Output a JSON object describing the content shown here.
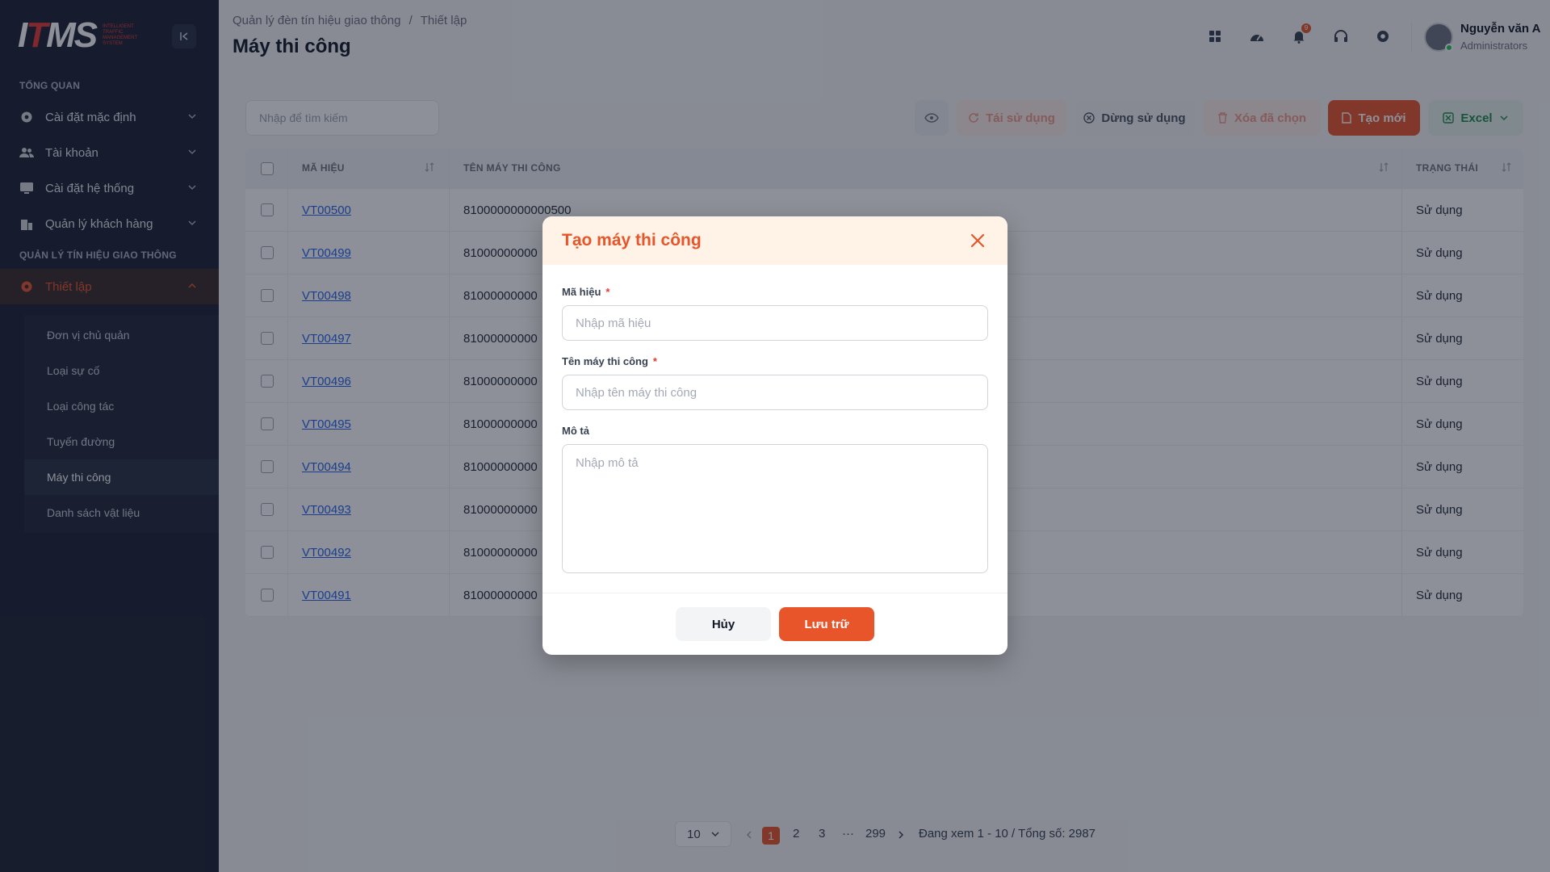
{
  "app": {
    "logo_text": "ITMS",
    "logo_subtitle": "INTELLIGENT TRAFFIC MANAGEMENT SYSTEM"
  },
  "sidebar": {
    "section_overview": "TỔNG QUAN",
    "items": [
      {
        "label": "Cài đặt mặc định",
        "icon": "gear-icon"
      },
      {
        "label": "Tài khoản",
        "icon": "users-icon"
      },
      {
        "label": "Cài đặt hệ thống",
        "icon": "monitor-icon"
      },
      {
        "label": "Quản lý khách hàng",
        "icon": "building-icon"
      }
    ],
    "section_traffic": "QUẢN LÝ TÍN HIỆU GIAO THÔNG",
    "active_item": {
      "label": "Thiết lập",
      "icon": "gear-icon"
    },
    "sub_items": [
      "Đơn vị chủ quản",
      "Loại sự cố",
      "Loại công tác",
      "Tuyến đường",
      "Máy thi công",
      "Danh sách vật liệu"
    ]
  },
  "header": {
    "breadcrumb": [
      "Quản lý đèn tín hiệu giao thông",
      "Thiết lập"
    ],
    "breadcrumb_sep": "/",
    "title": "Máy thi công",
    "notification_count": "9",
    "user": {
      "name": "Nguyễn văn A",
      "role": "Administrators"
    }
  },
  "toolbar": {
    "search_placeholder": "Nhập để tìm kiếm",
    "reuse_label": "Tái sử dụng",
    "stop_label": "Dừng sử dụng",
    "delete_label": "Xóa đã chọn",
    "create_label": "Tạo mới",
    "excel_label": "Excel"
  },
  "table": {
    "columns": [
      "MÃ HIỆU",
      "TÊN MÁY THI CÔNG",
      "TRẠNG THÁI"
    ],
    "rows": [
      {
        "code": "VT00500",
        "name": "8100000000000500",
        "status": "Sử dụng"
      },
      {
        "code": "VT00499",
        "name": "81000000000",
        "status": "Sử dụng"
      },
      {
        "code": "VT00498",
        "name": "81000000000",
        "status": "Sử dụng"
      },
      {
        "code": "VT00497",
        "name": "81000000000",
        "status": "Sử dụng"
      },
      {
        "code": "VT00496",
        "name": "81000000000",
        "status": "Sử dụng"
      },
      {
        "code": "VT00495",
        "name": "81000000000",
        "status": "Sử dụng"
      },
      {
        "code": "VT00494",
        "name": "81000000000",
        "status": "Sử dụng"
      },
      {
        "code": "VT00493",
        "name": "81000000000",
        "status": "Sử dụng"
      },
      {
        "code": "VT00492",
        "name": "81000000000",
        "status": "Sử dụng"
      },
      {
        "code": "VT00491",
        "name": "81000000000",
        "status": "Sử dụng"
      }
    ]
  },
  "pagination": {
    "page_size": "10",
    "pages": [
      "1",
      "2",
      "3",
      "···",
      "299"
    ],
    "current": "1",
    "info": "Đang xem 1 - 10 / Tổng số: 2987"
  },
  "modal": {
    "title": "Tạo máy thi công",
    "code_label": "Mã hiệu",
    "code_placeholder": "Nhập mã hiệu",
    "name_label": "Tên máy thi công",
    "name_placeholder": "Nhập tên máy thi công",
    "desc_label": "Mô tả",
    "desc_placeholder": "Nhập mô tả",
    "required_mark": "*",
    "cancel_label": "Hủy",
    "save_label": "Lưu trữ"
  },
  "colors": {
    "accent": "#e8552b",
    "sidebar_bg": "#1c2133",
    "link": "#2563eb"
  }
}
